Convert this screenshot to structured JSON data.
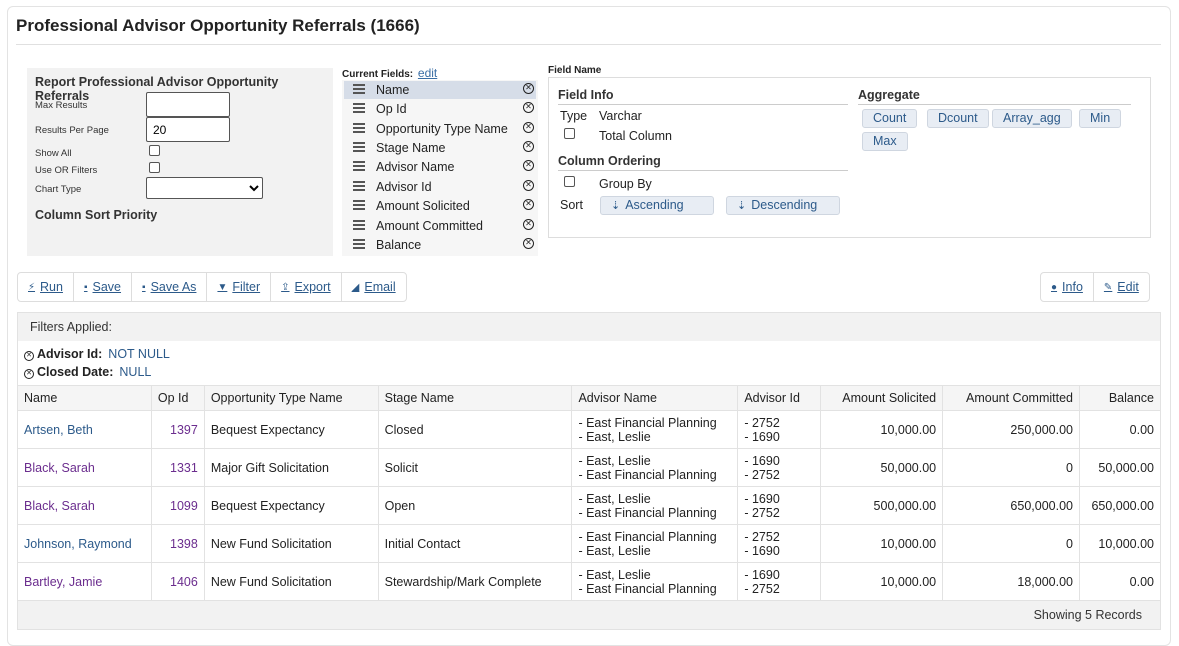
{
  "page": {
    "title": "Professional Advisor Opportunity Referrals (1666)"
  },
  "settings": {
    "heading": "Report Professional Advisor Opportunity Referrals",
    "max_results_label": "Max Results",
    "max_results_value": "",
    "results_per_page_label": "Results Per Page",
    "results_per_page_value": "20",
    "show_all_label": "Show All",
    "use_or_filters_label": "Use OR Filters",
    "chart_type_label": "Chart Type",
    "chart_type_value": "",
    "column_sort_priority": "Column Sort Priority"
  },
  "current_fields": {
    "label": "Current Fields:",
    "edit_link": "edit",
    "items": [
      "Name",
      "Op Id",
      "Opportunity Type Name",
      "Stage Name",
      "Advisor Name",
      "Advisor Id",
      "Amount Solicited",
      "Amount Committed",
      "Balance"
    ]
  },
  "field_panel": {
    "label": "Field Name",
    "field_info": "Field Info",
    "type_label": "Type",
    "type_value": "Varchar",
    "total_column": "Total Column",
    "column_ordering": "Column Ordering",
    "group_by": "Group By",
    "sort_label": "Sort",
    "ascending": "Ascending",
    "descending": "Descending",
    "aggregate": "Aggregate",
    "aggregates": [
      "Count",
      "Dcount",
      "Array_agg",
      "Min",
      "Max"
    ]
  },
  "toolbar": {
    "left": [
      "Run",
      "Save",
      "Save As",
      "Filter",
      "Export",
      "Email"
    ],
    "right": [
      "Info",
      "Edit"
    ]
  },
  "filters": {
    "title": "Filters Applied:",
    "items": [
      {
        "key": "Advisor Id:",
        "value": "NOT NULL"
      },
      {
        "key": "Closed Date:",
        "value": "NULL"
      }
    ]
  },
  "table": {
    "headers": [
      "Name",
      "Op Id",
      "Opportunity Type Name",
      "Stage Name",
      "Advisor Name",
      "Advisor Id",
      "Amount Solicited",
      "Amount Committed",
      "Balance"
    ],
    "rows": [
      {
        "name": "Artsen, Beth",
        "op_id": "1397",
        "type": "Bequest Expectancy",
        "stage": "Closed",
        "advisor1": "- East Financial Planning",
        "advisor2": "- East, Leslie",
        "aid1": "- 2752",
        "aid2": "- 1690",
        "solicited": "10,000.00",
        "committed": "250,000.00",
        "balance": "0.00"
      },
      {
        "name": "Black, Sarah",
        "op_id": "1331",
        "type": "Major Gift Solicitation",
        "stage": "Solicit",
        "advisor1": "- East, Leslie",
        "advisor2": "- East Financial Planning",
        "aid1": "- 1690",
        "aid2": "- 2752",
        "solicited": "50,000.00",
        "committed": "0",
        "balance": "50,000.00"
      },
      {
        "name": "Black, Sarah",
        "op_id": "1099",
        "type": "Bequest Expectancy",
        "stage": "Open",
        "advisor1": "- East, Leslie",
        "advisor2": "- East Financial Planning",
        "aid1": "- 1690",
        "aid2": "- 2752",
        "solicited": "500,000.00",
        "committed": "650,000.00",
        "balance": "650,000.00"
      },
      {
        "name": "Johnson, Raymond",
        "op_id": "1398",
        "type": "New Fund Solicitation",
        "stage": "Initial Contact",
        "advisor1": "- East Financial Planning",
        "advisor2": "- East, Leslie",
        "aid1": "- 2752",
        "aid2": "- 1690",
        "solicited": "10,000.00",
        "committed": "0",
        "balance": "10,000.00"
      },
      {
        "name": "Bartley, Jamie",
        "op_id": "1406",
        "type": "New Fund Solicitation",
        "stage": "Stewardship/Mark Complete",
        "advisor1": "- East, Leslie",
        "advisor2": "- East Financial Planning",
        "aid1": "- 1690",
        "aid2": "- 2752",
        "solicited": "10,000.00",
        "committed": "18,000.00",
        "balance": "0.00"
      }
    ],
    "footer": "Showing 5 Records"
  }
}
